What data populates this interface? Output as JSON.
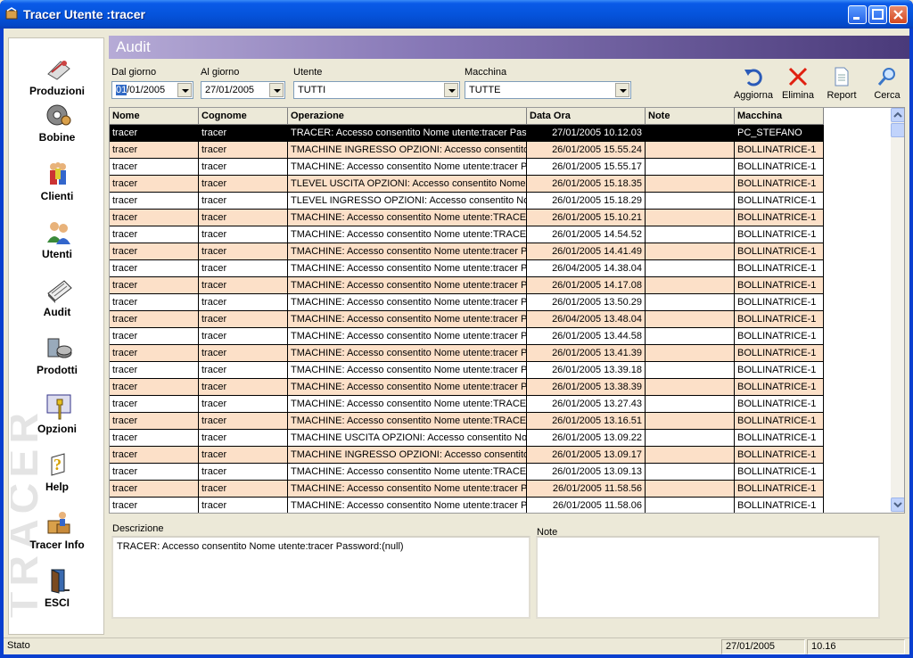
{
  "window": {
    "title": "Tracer Utente :tracer"
  },
  "sidebar": {
    "items": [
      {
        "label": "Produzioni",
        "icon": "produzioni-icon"
      },
      {
        "label": "Bobine",
        "icon": "bobine-icon"
      },
      {
        "label": "Clienti",
        "icon": "clienti-icon"
      },
      {
        "label": "Utenti",
        "icon": "utenti-icon"
      },
      {
        "label": "Audit",
        "icon": "audit-icon"
      },
      {
        "label": "Prodotti",
        "icon": "prodotti-icon"
      },
      {
        "label": "Opzioni",
        "icon": "opzioni-icon"
      },
      {
        "label": "Help",
        "icon": "help-icon"
      },
      {
        "label": "Tracer Info",
        "icon": "tracer-info-icon"
      },
      {
        "label": "ESCI",
        "icon": "esci-icon"
      }
    ]
  },
  "header": {
    "title": "Audit"
  },
  "filters": {
    "dal_label": "Dal giorno",
    "dal_value_sel": "01",
    "dal_value_rest": "/01/2005",
    "al_label": "Al giorno",
    "al_value": "27/01/2005",
    "utente_label": "Utente",
    "utente_value": "TUTTI",
    "macchina_label": "Macchina",
    "macchina_value": "TUTTE"
  },
  "toolbar": {
    "aggiorna": "Aggiorna",
    "elimina": "Elimina",
    "report": "Report",
    "cerca": "Cerca"
  },
  "table": {
    "columns": [
      "Nome",
      "Cognome",
      "Operazione",
      "Data Ora",
      "Note",
      "Macchina"
    ],
    "selected_row": 0,
    "rows": [
      [
        "tracer",
        "tracer",
        "TRACER: Accesso consentito  Nome utente:tracer Password:(null)",
        "27/01/2005 10.12.03",
        "",
        "PC_STEFANO"
      ],
      [
        "tracer",
        "tracer",
        "TMACHINE INGRESSO OPZIONI: Accesso consentito",
        "26/01/2005 15.55.24",
        "",
        "BOLLINATRICE-1"
      ],
      [
        "tracer",
        "tracer",
        "TMACHINE: Accesso consentito  Nome utente:tracer Password",
        "26/01/2005 15.55.17",
        "",
        "BOLLINATRICE-1"
      ],
      [
        "tracer",
        "tracer",
        "TLEVEL USCITA OPZIONI: Accesso consentito  Nome utente",
        "26/01/2005 15.18.35",
        "",
        "BOLLINATRICE-1"
      ],
      [
        "tracer",
        "tracer",
        "TLEVEL INGRESSO OPZIONI: Accesso consentito  Nome",
        "26/01/2005 15.18.29",
        "",
        "BOLLINATRICE-1"
      ],
      [
        "tracer",
        "tracer",
        "TMACHINE: Accesso consentito  Nome utente:TRACER",
        "26/01/2005 15.10.21",
        "",
        "BOLLINATRICE-1"
      ],
      [
        "tracer",
        "tracer",
        "TMACHINE: Accesso consentito  Nome utente:TRACER",
        "26/01/2005 14.54.52",
        "",
        "BOLLINATRICE-1"
      ],
      [
        "tracer",
        "tracer",
        "TMACHINE: Accesso consentito  Nome utente:tracer Password",
        "26/01/2005 14.41.49",
        "",
        "BOLLINATRICE-1"
      ],
      [
        "tracer",
        "tracer",
        "TMACHINE: Accesso consentito  Nome utente:tracer Password",
        "26/04/2005 14.38.04",
        "",
        "BOLLINATRICE-1"
      ],
      [
        "tracer",
        "tracer",
        "TMACHINE: Accesso consentito  Nome utente:tracer Password",
        "26/01/2005 14.17.08",
        "",
        "BOLLINATRICE-1"
      ],
      [
        "tracer",
        "tracer",
        "TMACHINE: Accesso consentito  Nome utente:tracer Password",
        "26/01/2005 13.50.29",
        "",
        "BOLLINATRICE-1"
      ],
      [
        "tracer",
        "tracer",
        "TMACHINE: Accesso consentito  Nome utente:tracer Password",
        "26/04/2005 13.48.04",
        "",
        "BOLLINATRICE-1"
      ],
      [
        "tracer",
        "tracer",
        "TMACHINE: Accesso consentito  Nome utente:tracer Password",
        "26/01/2005 13.44.58",
        "",
        "BOLLINATRICE-1"
      ],
      [
        "tracer",
        "tracer",
        "TMACHINE: Accesso consentito  Nome utente:tracer Password",
        "26/01/2005 13.41.39",
        "",
        "BOLLINATRICE-1"
      ],
      [
        "tracer",
        "tracer",
        "TMACHINE: Accesso consentito  Nome utente:tracer Password",
        "26/01/2005 13.39.18",
        "",
        "BOLLINATRICE-1"
      ],
      [
        "tracer",
        "tracer",
        "TMACHINE: Accesso consentito  Nome utente:tracer Password",
        "26/01/2005 13.38.39",
        "",
        "BOLLINATRICE-1"
      ],
      [
        "tracer",
        "tracer",
        "TMACHINE: Accesso consentito  Nome utente:TRACER",
        "26/01/2005 13.27.43",
        "",
        "BOLLINATRICE-1"
      ],
      [
        "tracer",
        "tracer",
        "TMACHINE: Accesso consentito  Nome utente:TRACER",
        "26/01/2005 13.16.51",
        "",
        "BOLLINATRICE-1"
      ],
      [
        "tracer",
        "tracer",
        "TMACHINE USCITA OPZIONI: Accesso consentito  Nome",
        "26/01/2005 13.09.22",
        "",
        "BOLLINATRICE-1"
      ],
      [
        "tracer",
        "tracer",
        "TMACHINE INGRESSO OPZIONI: Accesso consentito",
        "26/01/2005 13.09.17",
        "",
        "BOLLINATRICE-1"
      ],
      [
        "tracer",
        "tracer",
        "TMACHINE: Accesso consentito  Nome utente:TRACER",
        "26/01/2005 13.09.13",
        "",
        "BOLLINATRICE-1"
      ],
      [
        "tracer",
        "tracer",
        "TMACHINE: Accesso consentito  Nome utente:tracer Password",
        "26/01/2005 11.58.56",
        "",
        "BOLLINATRICE-1"
      ],
      [
        "tracer",
        "tracer",
        "TMACHINE: Accesso consentito  Nome utente:tracer Password",
        "26/01/2005 11.58.06",
        "",
        "BOLLINATRICE-1"
      ]
    ]
  },
  "details": {
    "descrizione_label": "Descrizione",
    "descrizione_value": "TRACER: Accesso consentito  Nome utente:tracer Password:(null)",
    "note_label": "Note",
    "note_value": ""
  },
  "status": {
    "stato": "Stato",
    "date": "27/01/2005",
    "time": "10.16"
  },
  "colors": {
    "row_alt": "#fce0c8",
    "selected": "#000000",
    "title_blue": "#0554dc"
  }
}
